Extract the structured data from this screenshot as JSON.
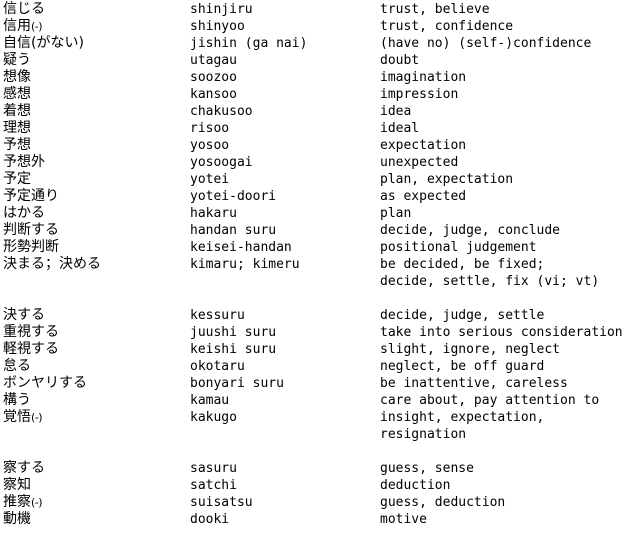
{
  "document": {
    "type": "vocabulary-list",
    "columns": [
      "japanese",
      "romaji",
      "english"
    ],
    "rows": [
      {
        "japanese": "信じる",
        "romaji": "shinjiru",
        "english": "trust, believe"
      },
      {
        "japanese": "信用",
        "japanese_suffix": "(-)",
        "romaji": "shinyoo",
        "english": "trust, confidence"
      },
      {
        "japanese": "自信(がない)",
        "romaji": "jishin (ga nai)",
        "english": "(have no) (self-)confidence"
      },
      {
        "japanese": "疑う",
        "romaji": "utagau",
        "english": "doubt"
      },
      {
        "japanese": "想像",
        "romaji": "soozoo",
        "english": "imagination"
      },
      {
        "japanese": "感想",
        "romaji": "kansoo",
        "english": "impression"
      },
      {
        "japanese": "着想",
        "romaji": "chakusoo",
        "english": "idea"
      },
      {
        "japanese": "理想",
        "romaji": "risoo",
        "english": "ideal"
      },
      {
        "japanese": "予想",
        "romaji": "yosoo",
        "english": "expectation"
      },
      {
        "japanese": "予想外",
        "romaji": "yosoogai",
        "english": "unexpected"
      },
      {
        "japanese": "予定",
        "romaji": "yotei",
        "english": "plan, expectation"
      },
      {
        "japanese": "予定通り",
        "romaji": "yotei-doori",
        "english": "as expected"
      },
      {
        "japanese": "はかる",
        "romaji": "hakaru",
        "english": "plan"
      },
      {
        "japanese": "判断する",
        "romaji": "handan suru",
        "english": "decide, judge, conclude"
      },
      {
        "japanese": "形勢判断",
        "romaji": "keisei-handan",
        "english": "positional judgement"
      },
      {
        "japanese": "決まる；決める",
        "romaji": "kimaru; kimeru",
        "english": "be decided, be fixed;\ndecide, settle, fix (vi; vt)",
        "tall": true
      },
      {
        "spacer": true
      },
      {
        "japanese": "決する",
        "romaji": "kessuru",
        "english": "decide, judge, settle"
      },
      {
        "japanese": "重視する",
        "romaji": "juushi suru",
        "english": "take into serious consideration"
      },
      {
        "japanese": "軽視する",
        "romaji": "keishi suru",
        "english": "slight, ignore, neglect"
      },
      {
        "japanese": "怠る",
        "romaji": "okotaru",
        "english": "neglect, be off guard"
      },
      {
        "japanese": "ボンヤリする",
        "romaji": "bonyari suru",
        "english": "be inattentive, careless"
      },
      {
        "japanese": "構う",
        "romaji": "kamau",
        "english": "care about, pay attention to"
      },
      {
        "japanese": "覚悟",
        "japanese_suffix": "(-)",
        "romaji": "kakugo",
        "english": "insight, expectation,\nresignation",
        "tall": true
      },
      {
        "spacer": true
      },
      {
        "japanese": "察する",
        "romaji": "sasuru",
        "english": "guess, sense"
      },
      {
        "japanese": "察知",
        "romaji": "satchi",
        "english": "deduction"
      },
      {
        "japanese": "推察",
        "japanese_suffix": "(-)",
        "romaji": "suisatsu",
        "english": "guess, deduction"
      },
      {
        "japanese": "動機",
        "romaji": "dooki",
        "english": "motive"
      }
    ]
  }
}
